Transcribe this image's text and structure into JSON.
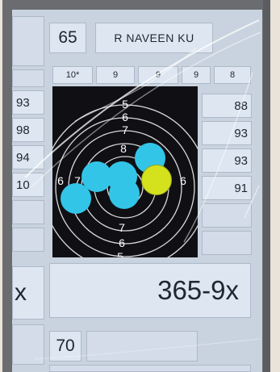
{
  "header": {
    "lane_number": "65",
    "shooter_name": "R NAVEEN KU"
  },
  "score_ticks": [
    "10*",
    "9",
    "9",
    "9",
    "8"
  ],
  "left_column_scores": [
    "93",
    "98",
    "94",
    "10"
  ],
  "right_column_scores": [
    "88",
    "93",
    "93",
    "91"
  ],
  "target": {
    "ring_numbers_top": [
      "5",
      "6",
      "7",
      "8"
    ],
    "ring_numbers_left": [
      "6",
      "7"
    ],
    "ring_numbers_right": [
      "6"
    ],
    "ring_numbers_bottom": [
      "7",
      "6",
      "5"
    ],
    "shot_colors": {
      "previous": "#33c5e8",
      "last": "#d4e21e"
    }
  },
  "total": {
    "score": "365-9x",
    "left_partial": "x"
  },
  "next_lane": {
    "lane_number": "70"
  }
}
